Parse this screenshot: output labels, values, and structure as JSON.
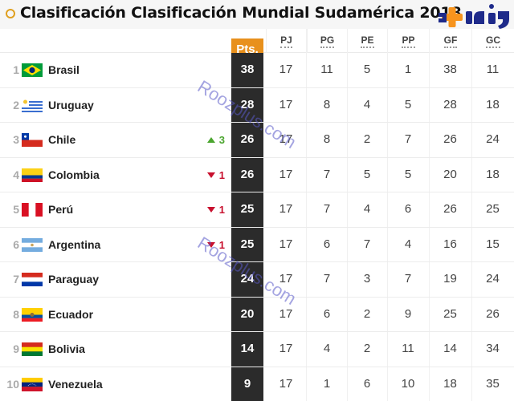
{
  "title": "Clasificación Clasificación Mundial Sudamérica 2018",
  "logo": {
    "icon": "plus-icon",
    "text": "روز",
    "colors": {
      "plus": "#f7941d",
      "text": "#1e2a8a"
    }
  },
  "columns": {
    "pts": "Pts.",
    "pj": "PJ",
    "pg": "PG",
    "pe": "PE",
    "pp": "PP",
    "gf": "GF",
    "gc": "GC"
  },
  "colors": {
    "accent": "#e8901c",
    "pts_column": "#2b2b2b",
    "up": "#4aa52e",
    "down": "#c8102e"
  },
  "rows": [
    {
      "rank": "1",
      "team": "Brasil",
      "flag": "brazil-flag",
      "change": "",
      "dir": "",
      "pts": "38",
      "pj": "17",
      "pg": "11",
      "pe": "5",
      "pp": "1",
      "gf": "38",
      "gc": "11"
    },
    {
      "rank": "2",
      "team": "Uruguay",
      "flag": "uruguay-flag",
      "change": "",
      "dir": "",
      "pts": "28",
      "pj": "17",
      "pg": "8",
      "pe": "4",
      "pp": "5",
      "gf": "28",
      "gc": "18"
    },
    {
      "rank": "3",
      "team": "Chile",
      "flag": "chile-flag",
      "change": "3",
      "dir": "up",
      "pts": "26",
      "pj": "17",
      "pg": "8",
      "pe": "2",
      "pp": "7",
      "gf": "26",
      "gc": "24"
    },
    {
      "rank": "4",
      "team": "Colombia",
      "flag": "colombia-flag",
      "change": "1",
      "dir": "down",
      "pts": "26",
      "pj": "17",
      "pg": "7",
      "pe": "5",
      "pp": "5",
      "gf": "20",
      "gc": "18"
    },
    {
      "rank": "5",
      "team": "Perú",
      "flag": "peru-flag",
      "change": "1",
      "dir": "down",
      "pts": "25",
      "pj": "17",
      "pg": "7",
      "pe": "4",
      "pp": "6",
      "gf": "26",
      "gc": "25"
    },
    {
      "rank": "6",
      "team": "Argentina",
      "flag": "argentina-flag",
      "change": "1",
      "dir": "down",
      "pts": "25",
      "pj": "17",
      "pg": "6",
      "pe": "7",
      "pp": "4",
      "gf": "16",
      "gc": "15"
    },
    {
      "rank": "7",
      "team": "Paraguay",
      "flag": "paraguay-flag",
      "change": "",
      "dir": "",
      "pts": "24",
      "pj": "17",
      "pg": "7",
      "pe": "3",
      "pp": "7",
      "gf": "19",
      "gc": "24"
    },
    {
      "rank": "8",
      "team": "Ecuador",
      "flag": "ecuador-flag",
      "change": "",
      "dir": "",
      "pts": "20",
      "pj": "17",
      "pg": "6",
      "pe": "2",
      "pp": "9",
      "gf": "25",
      "gc": "26"
    },
    {
      "rank": "9",
      "team": "Bolivia",
      "flag": "bolivia-flag",
      "change": "",
      "dir": "",
      "pts": "14",
      "pj": "17",
      "pg": "4",
      "pe": "2",
      "pp": "11",
      "gf": "14",
      "gc": "34"
    },
    {
      "rank": "10",
      "team": "Venezuela",
      "flag": "venezuela-flag",
      "change": "",
      "dir": "",
      "pts": "9",
      "pj": "17",
      "pg": "1",
      "pe": "6",
      "pp": "10",
      "gf": "18",
      "gc": "35"
    }
  ],
  "watermark": "Roozplus.com"
}
